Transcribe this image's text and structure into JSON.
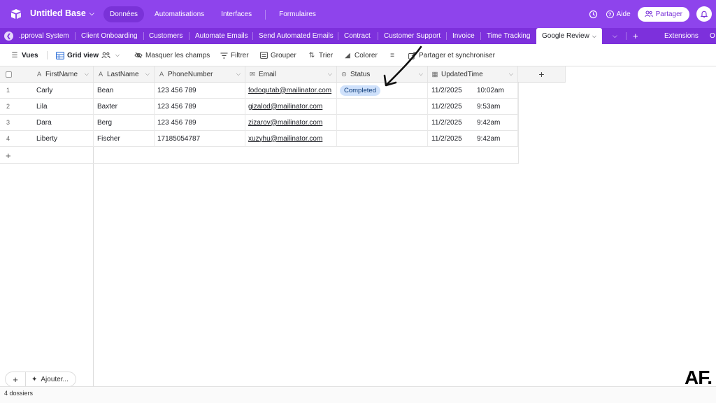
{
  "header": {
    "base_title": "Untitled Base",
    "nav": [
      "Données",
      "Automatisations",
      "Interfaces",
      "Formulaires"
    ],
    "help": "Aide",
    "share": "Partager"
  },
  "tabs": [
    ".pproval System",
    "Client Onboarding",
    "Customers",
    "Automate Emails",
    "Send Automated Emails",
    "Contract",
    "Customer Support",
    "Invoice",
    "Time Tracking",
    "Google Review"
  ],
  "tabs_extra": {
    "extensions": "Extensions",
    "overflow": "O"
  },
  "toolbar": {
    "views": "Vues",
    "grid_view": "Grid view",
    "hide_fields": "Masquer les champs",
    "filter": "Filtrer",
    "group": "Grouper",
    "sort": "Trier",
    "color": "Colorer",
    "share_sync": "Partager et synchroniser"
  },
  "table": {
    "columns": [
      "FirstName",
      "LastName",
      "PhoneNumber",
      "Email",
      "Status",
      "UpdatedTime"
    ],
    "rows": [
      {
        "num": "1",
        "first": "Carly",
        "last": "Bean",
        "phone": "123 456 789",
        "email": "fodoqutab@mailinator.com",
        "status": "Completed",
        "date": "11/2/2025",
        "time": "10:02am"
      },
      {
        "num": "2",
        "first": "Lila",
        "last": "Baxter",
        "phone": "123 456 789",
        "email": "gizalod@mailinator.com",
        "status": "",
        "date": "11/2/2025",
        "time": "9:53am"
      },
      {
        "num": "3",
        "first": "Dara",
        "last": "Berg",
        "phone": "123 456 789",
        "email": "zizarov@mailinator.com",
        "status": "",
        "date": "11/2/2025",
        "time": "9:42am"
      },
      {
        "num": "4",
        "first": "Liberty",
        "last": "Fischer",
        "phone": "17185054787",
        "email": "xuzyhu@mailinator.com",
        "status": "",
        "date": "11/2/2025",
        "time": "9:42am"
      }
    ]
  },
  "bottom": {
    "add_label": "Ajouter...",
    "folder_count": "4 dossiers"
  },
  "watermark": "AF.",
  "colors": {
    "header": "#8e44ec",
    "tabs": "#7d30dc",
    "pill_bg": "#cfe1fb",
    "pill_text": "#0b3a78"
  }
}
